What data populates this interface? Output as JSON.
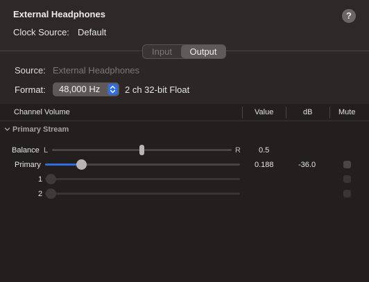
{
  "header": {
    "title": "External Headphones",
    "help_label": "?",
    "clock_source_label": "Clock Source:",
    "clock_source_value": "Default"
  },
  "tabs": {
    "input_label": "Input",
    "output_label": "Output",
    "selected": "Output"
  },
  "device": {
    "source_label": "Source:",
    "source_value": "External Headphones",
    "format_label": "Format:",
    "format_value": "48,000 Hz",
    "format_desc": "2 ch 32-bit Float"
  },
  "table": {
    "columns": [
      "Channel Volume",
      "Value",
      "dB",
      "Mute"
    ],
    "group": "Primary Stream",
    "balance": {
      "label": "Balance",
      "left": "L",
      "right": "R",
      "value": "0.5",
      "level": 0.5
    },
    "primary": {
      "label": "Primary",
      "value": "0.188",
      "db": "-36.0",
      "level": 0.188,
      "muted": false
    },
    "channels": [
      {
        "label": "1",
        "level": 0,
        "muted": false
      },
      {
        "label": "2",
        "level": 0,
        "muted": false
      }
    ]
  },
  "colors": {
    "accent": "#2f6ee0",
    "background": "#2c2626",
    "table_background": "#231f1f"
  }
}
